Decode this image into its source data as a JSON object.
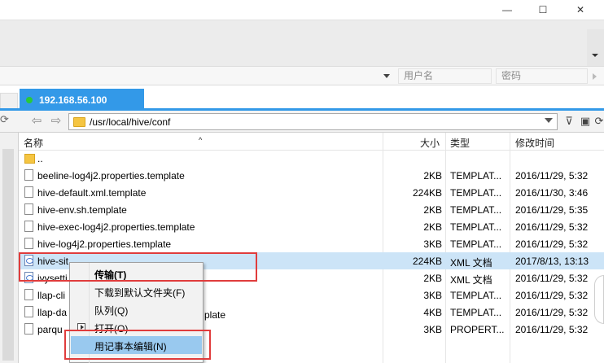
{
  "window": {
    "minimize_glyph": "—",
    "maximize_glyph": "☐",
    "close_glyph": "✕"
  },
  "connection": {
    "user_placeholder": "用户名",
    "password_placeholder": "密码"
  },
  "tabs": [
    {
      "label": "192.168.56.100",
      "status_color": "#29c93a"
    }
  ],
  "pathbar": {
    "back_glyph": "⇦",
    "forward_glyph": "⇨",
    "path": "/usr/local/hive/conf"
  },
  "columns": {
    "name": "名称",
    "size": "大小",
    "type": "类型",
    "modified": "修改时间"
  },
  "files": [
    {
      "name": "..",
      "size": "",
      "type": "",
      "date": "",
      "icon": "folder-icon"
    },
    {
      "name": "beeline-log4j2.properties.template",
      "size": "2KB",
      "type": "TEMPLAT...",
      "date": "2016/11/29, 5:32",
      "icon": "file-icon"
    },
    {
      "name": "hive-default.xml.template",
      "size": "224KB",
      "type": "TEMPLAT...",
      "date": "2016/11/30, 3:46",
      "icon": "file-icon"
    },
    {
      "name": "hive-env.sh.template",
      "size": "2KB",
      "type": "TEMPLAT...",
      "date": "2016/11/29, 5:35",
      "icon": "file-icon"
    },
    {
      "name": "hive-exec-log4j2.properties.template",
      "size": "2KB",
      "type": "TEMPLAT...",
      "date": "2016/11/29, 5:32",
      "icon": "file-icon"
    },
    {
      "name": "hive-log4j2.properties.template",
      "size": "3KB",
      "type": "TEMPLAT...",
      "date": "2016/11/29, 5:32",
      "icon": "file-icon"
    },
    {
      "name": "hive-sit",
      "size": "224KB",
      "type": "XML 文档",
      "date": "2017/8/13, 13:13",
      "icon": "xml-file-icon",
      "selected": true
    },
    {
      "name": "ivysetti",
      "size": "2KB",
      "type": "XML 文档",
      "date": "2016/11/29, 5:32",
      "icon": "xml-file-icon"
    },
    {
      "name": "llap-cli",
      "size": "3KB",
      "type": "TEMPLAT...",
      "date": "2016/11/29, 5:32",
      "icon": "file-icon"
    },
    {
      "name": "llap-da",
      "size": "4KB",
      "type": "TEMPLAT...",
      "date": "2016/11/29, 5:32",
      "icon": "file-icon"
    },
    {
      "name": "parqu",
      "size": "3KB",
      "type": "PROPERT...",
      "date": "2016/11/29, 5:32",
      "icon": "file-icon"
    }
  ],
  "file_tail_under_menu": "plate",
  "context_menu": {
    "items": [
      {
        "label": "传输(T)",
        "bold": true
      },
      {
        "label": "下载到默认文件夹(F)"
      },
      {
        "label": "队列(Q)"
      },
      {
        "label": "打开(O)",
        "icon": "open-icon"
      },
      {
        "label": "用记事本编辑(N)",
        "highlighted": true
      }
    ]
  },
  "colors": {
    "tab_active": "#3399e8",
    "selection": "#cce4f7",
    "menu_highlight": "#99c9ef",
    "annotation_red": "#e03c3c"
  }
}
